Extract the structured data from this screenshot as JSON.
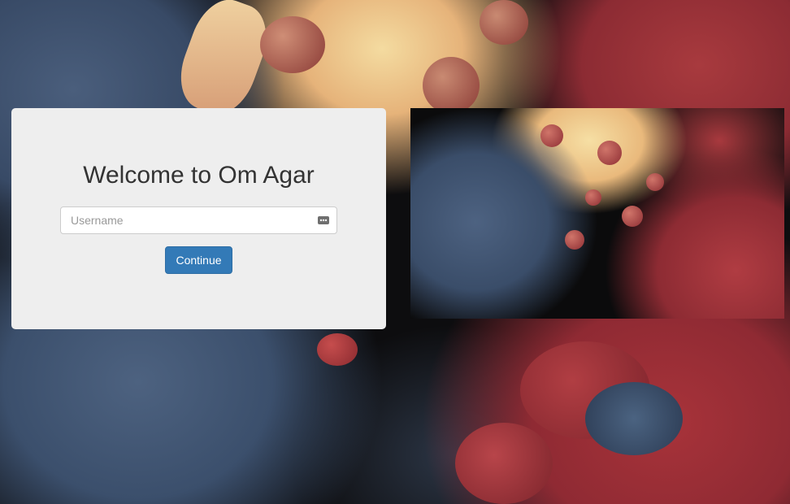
{
  "login": {
    "title": "Welcome to Om Agar",
    "username_placeholder": "Username",
    "username_value": "",
    "continue_label": "Continue"
  },
  "icons": {
    "keychain": "keychain-autofill-icon"
  },
  "colors": {
    "card_background": "#eeeeee",
    "button_primary": "#337ab7",
    "title_text": "#333333"
  }
}
